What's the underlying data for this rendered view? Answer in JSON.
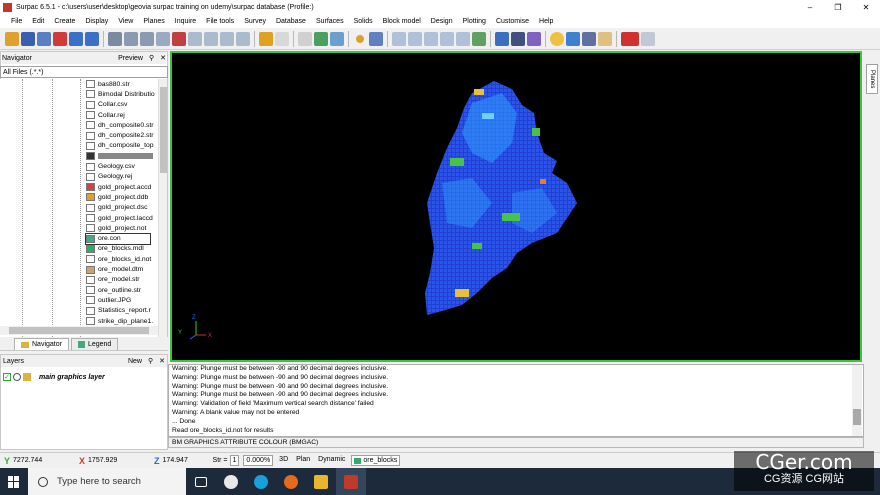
{
  "window": {
    "title": "Surpac 6.5.1 - c:\\users\\user\\desktop\\geovia surpac training on udemy\\surpac database (Profile:)"
  },
  "menu": [
    "File",
    "Edit",
    "Create",
    "Display",
    "View",
    "Planes",
    "Inquire",
    "File tools",
    "Survey",
    "Database",
    "Surfaces",
    "Solids",
    "Block model",
    "Design",
    "Plotting",
    "Customise",
    "Help"
  ],
  "navigator": {
    "title": "Navigator",
    "preview_label": "Preview",
    "filter": "All Files (.*.*)",
    "files": [
      "bas880.str",
      "Bimodal Distributio",
      "Collar.csv",
      "Collar.rej",
      "dh_composite0.str",
      "dh_composite2.str",
      "dh_composite_top",
      "",
      "Geology.csv",
      "Geology.rej",
      "gold_project.accd",
      "gold_project.ddb",
      "gold_project.dsc",
      "gold_project.laccd",
      "gold_project.not",
      "ore.con",
      "ore_blocks.mdl",
      "ore_blocks_id.not",
      "ore_model.dtm",
      "ore_model.str",
      "ore_outline.str",
      "outlier.JPG",
      "Statistics_report.r",
      "strike_dip_plane1."
    ],
    "tabs": [
      "Navigator",
      "Legend"
    ]
  },
  "layers": {
    "title": "Layers",
    "new_label": "New",
    "items": [
      "main graphics layer"
    ]
  },
  "planes_tab": "Planes",
  "log": {
    "lines": [
      "Warning: Plunge must be between -90 and 90 decimal degrees inclusive.",
      "Warning: Plunge must be between -90 and 90 decimal degrees inclusive.",
      "Warning: Plunge must be between -90 and 90 decimal degrees inclusive.",
      "Warning: Plunge must be between -90 and 90 decimal degrees inclusive.",
      "Warning: Validation of field 'Maximum vertical search distance' failed",
      "Warning: A blank value may not be entered",
      "... Done",
      "Read ore_blocks_id.not for results"
    ],
    "command": "BM GRAPHICS ATTRIBUTE COLOUR (BMGAC)"
  },
  "status": {
    "y": "7272.744",
    "x": "1757.929",
    "z": "174.947",
    "str_label": "Str =",
    "str_value": "1",
    "zoom": "0.000%",
    "mode_3d": "3D",
    "plan": "Plan",
    "dynamic": "Dynamic",
    "layer": "ore_blocks"
  },
  "taskbar": {
    "search_placeholder": "Type here to search"
  },
  "watermark": {
    "line1": "CGer.com",
    "line2": "CG资源 CG网站"
  },
  "colors": {
    "viewport_border": "#3cc43c",
    "model_blue": "#1f3fd6",
    "model_cyan": "#2f9fff",
    "model_green": "#47c24a",
    "model_yellow": "#e6c23a"
  }
}
